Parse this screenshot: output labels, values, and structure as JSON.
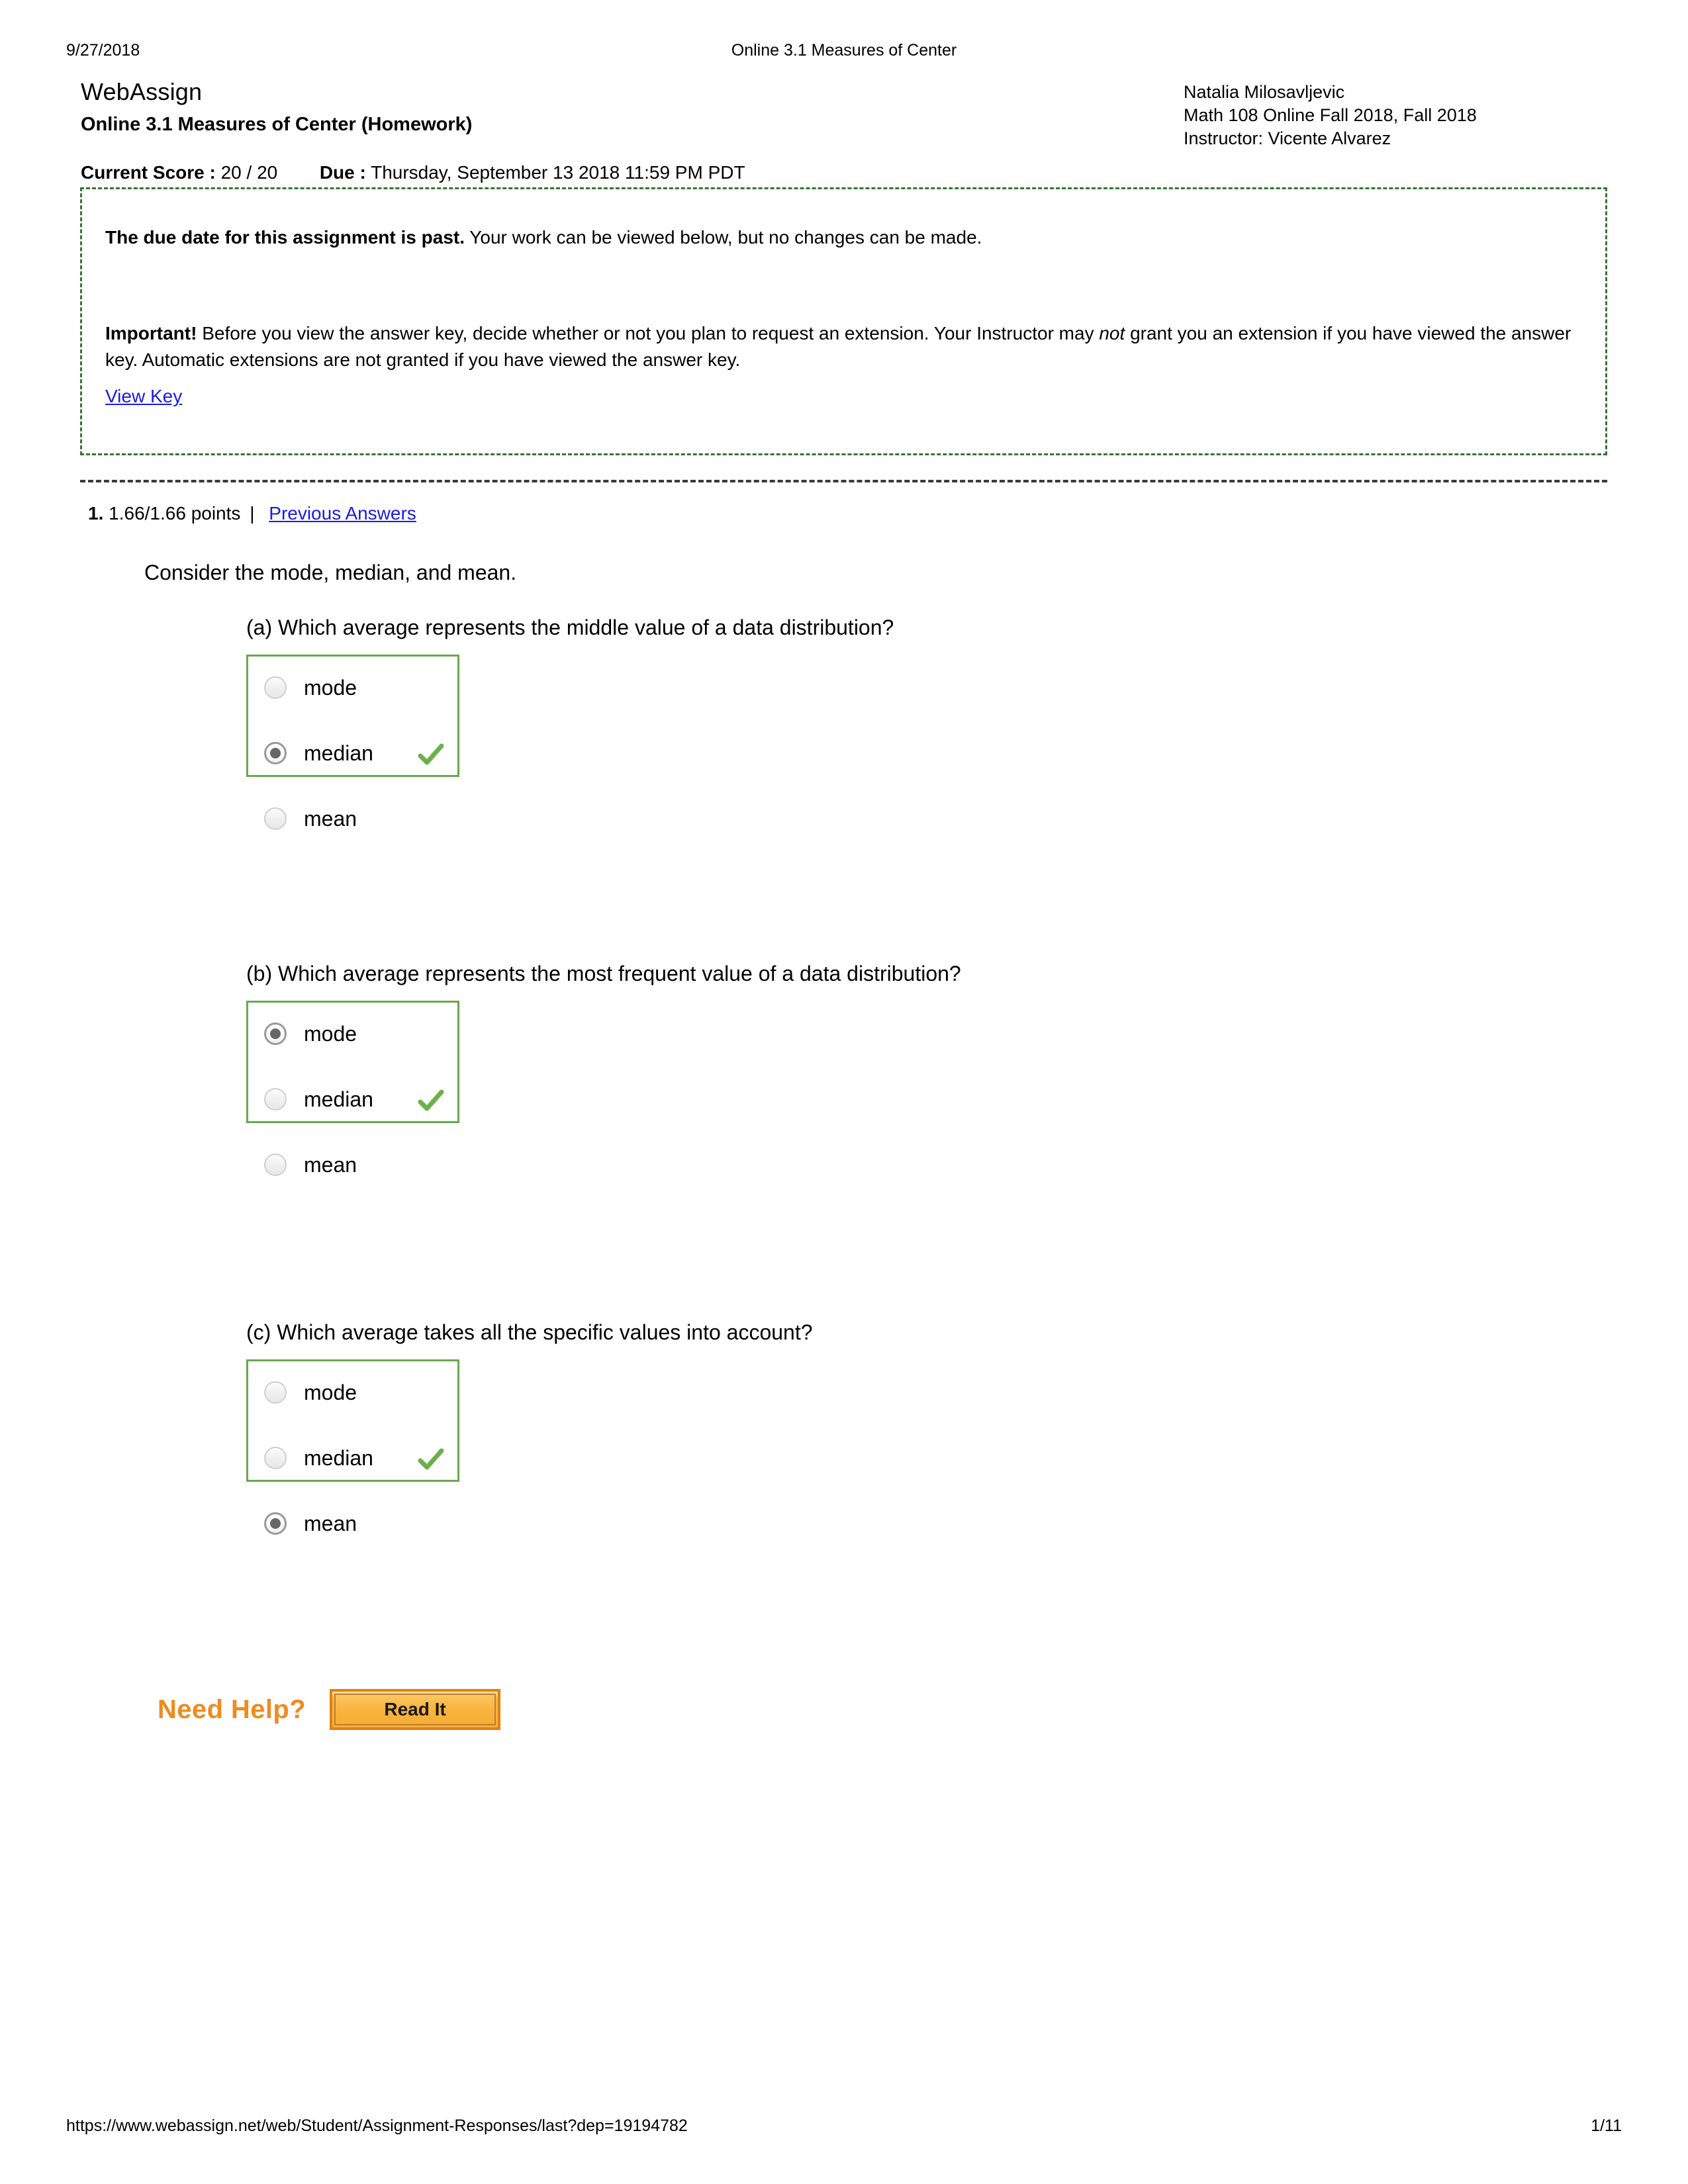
{
  "print_header": {
    "date": "9/27/2018",
    "doc_title": "Online 3.1 Measures of Center"
  },
  "masthead": {
    "brand": "WebAssign",
    "assignment_name": "Online 3.1 Measures of Center (Homework)",
    "student_name": "Natalia Milosavljevic",
    "course": "Math 108 Online Fall 2018, Fall 2018",
    "instructor": "Instructor: Vicente Alvarez"
  },
  "score_bar": {
    "score_label": "Current Score :",
    "score_value": "20 / 20",
    "due_label": "Due :",
    "due_value": "Thursday, September 13 2018 11:59 PM PDT"
  },
  "notice": {
    "past_due_bold": "The due date for this assignment is past.",
    "past_due_text": " Your work can be viewed below, but no changes can be made.",
    "important_bold": "Important!",
    "important_text_1": " Before you view the answer key, decide whether or not you plan to request an extension. Your Instructor may ",
    "important_italic": "not",
    "important_text_2": " grant you an extension if you have viewed the answer key. Automatic extensions are not granted if you have viewed the answer key.",
    "view_key_link": "View Key",
    "border_color": "#3a7238"
  },
  "question": {
    "number": "1.",
    "points": "1.66/1.66 points",
    "divider": "|",
    "previous_answers_link": "Previous Answers",
    "intro": "Consider the mode, median, and mean.",
    "parts": [
      {
        "label": "(a) Which average represents the middle value of a data distribution?",
        "options": [
          "mode",
          "median",
          "mean"
        ],
        "selected": 1,
        "correct": true,
        "status_icon": "green-check-icon"
      },
      {
        "label": "(b) Which average represents the most frequent value of a data distribution?",
        "options": [
          "mode",
          "median",
          "mean"
        ],
        "selected": 0,
        "correct": true,
        "status_icon": "green-check-icon"
      },
      {
        "label": "(c) Which average takes all the specific values into account?",
        "options": [
          "mode",
          "median",
          "mean"
        ],
        "selected": 2,
        "correct": true,
        "status_icon": "green-check-icon"
      }
    ],
    "box_border_color": "#6aa84f"
  },
  "need_help": {
    "label": "Need Help?",
    "read_it_label": "Read It",
    "accent_color": "#ef8b1f"
  },
  "footer": {
    "url": "https://www.webassign.net/web/Student/Assignment-Responses/last?dep=19194782",
    "page": "1/11"
  }
}
